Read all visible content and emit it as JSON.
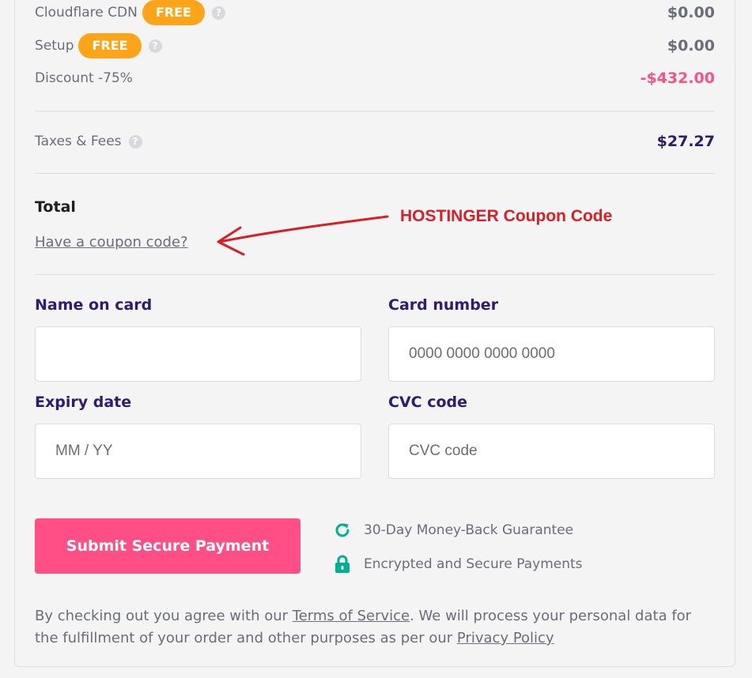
{
  "order": {
    "lines": [
      {
        "label": "Cloudflare CDN",
        "badge": "FREE",
        "amount": "$0.00"
      },
      {
        "label": "Setup",
        "badge": "FREE",
        "amount": "$0.00"
      },
      {
        "label": "Discount -75%",
        "amount": "-$432.00"
      }
    ],
    "taxes": {
      "label": "Taxes & Fees",
      "amount": "$27.27"
    },
    "help_icon": "?",
    "total_label": "Total",
    "coupon_link": "Have a coupon code?"
  },
  "annotation": {
    "text": "HOSTINGER Coupon Code",
    "color": "#d62027"
  },
  "payment_form": {
    "name": {
      "label": "Name on card",
      "value": "",
      "placeholder": ""
    },
    "card": {
      "label": "Card number",
      "placeholder": "0000 0000 0000 0000"
    },
    "expiry": {
      "label": "Expiry date",
      "placeholder": "MM / YY"
    },
    "cvc": {
      "label": "CVC code",
      "placeholder": "CVC code"
    }
  },
  "submit_label": "Submit Secure Payment",
  "guarantees": [
    {
      "icon": "refresh-icon",
      "text": "30-Day Money-Back Guarantee"
    },
    {
      "icon": "lock-icon",
      "text": "Encrypted and Secure Payments"
    }
  ],
  "legal": {
    "prefix": "By checking out you agree with our ",
    "terms": "Terms of Service",
    "middle": ". We will process your personal data for the fulfillment of your order and other purposes as per our ",
    "privacy": "Privacy Policy"
  },
  "colors": {
    "accent": "#ff4f86",
    "badge": "#fea419",
    "discount": "#f5548b",
    "icon_green": "#00b090"
  }
}
